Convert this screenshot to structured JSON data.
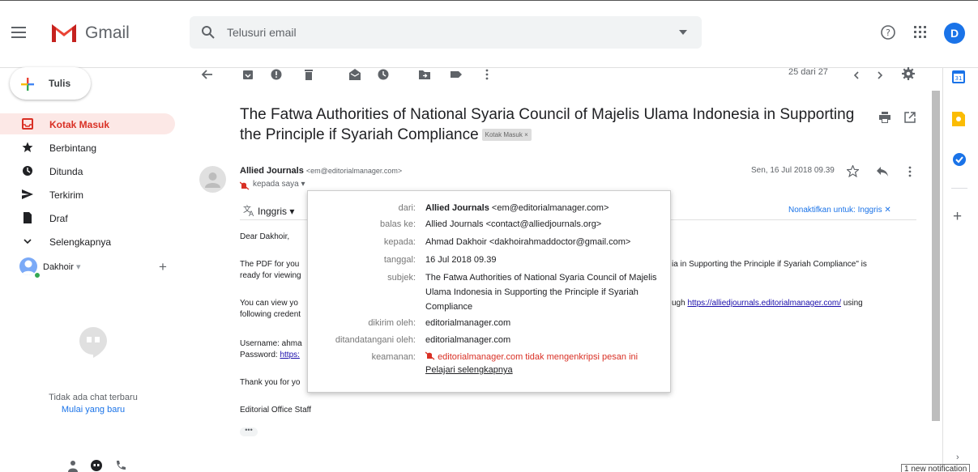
{
  "app": {
    "logo_text": "Gmail",
    "avatar_letter": "D"
  },
  "search": {
    "placeholder": "Telusuri email"
  },
  "compose": {
    "label": "Tulis"
  },
  "nav": [
    {
      "label": "Kotak Masuk",
      "icon": "inbox-icon",
      "active": true
    },
    {
      "label": "Berbintang",
      "icon": "star-icon",
      "active": false
    },
    {
      "label": "Ditunda",
      "icon": "clock-icon",
      "active": false
    },
    {
      "label": "Terkirim",
      "icon": "send-icon",
      "active": false
    },
    {
      "label": "Draf",
      "icon": "draft-icon",
      "active": false
    },
    {
      "label": "Selengkapnya",
      "icon": "chevron-down-icon",
      "active": false
    }
  ],
  "hangouts": {
    "user": "Dakhoir",
    "no_chat": "Tidak ada chat terbaru",
    "start_new": "Mulai yang baru"
  },
  "toolbar": {
    "count": "25 dari 27"
  },
  "email": {
    "subject": "The Fatwa Authorities of National Syaria Council of Majelis Ulama Indonesia in Supporting the Principle if Syariah Compliance",
    "label_chip": "Kotak Masuk ×",
    "sender_name": "Allied Journals",
    "sender_email": "<em@editorialmanager.com>",
    "recipient": "kepada saya",
    "date": "Sen, 16 Jul 2018 09.39",
    "translate_lang": "Inggris",
    "translate_off": "Nonaktifkan untuk: Inggris",
    "greeting": "Dear  Dakhoir,",
    "p1a": "The PDF for you",
    "p1b": "ia in Supporting the Principle if Syariah Compliance\" is",
    "p1c": "ready for viewing",
    "p2a": "You can view yo",
    "p2b": "ugh",
    "p2_link": "https://alliedjournals.editorialmanager.com/",
    "p2c": "using",
    "p2d": "following credent",
    "username": "Username: ahma",
    "password_label": "Password:",
    "password_link": "https:",
    "thanks": "Thank you for yo",
    "signature": "Editorial Office Staff",
    "ellipsis": "•••"
  },
  "popup": {
    "from_key": "dari:",
    "from_name": "Allied Journals",
    "from_email": "<em@editorialmanager.com>",
    "reply_key": "balas ke:",
    "reply_val": "Allied Journals <contact@alliedjournals.org>",
    "to_key": "kepada:",
    "to_val": "Ahmad Dakhoir <dakhoirahmaddoctor@gmail.com>",
    "date_key": "tanggal:",
    "date_val": "16 Jul 2018 09.39",
    "subject_key": "subjek:",
    "subject_val": "The Fatwa Authorities of National Syaria Council of Majelis Ulama Indonesia in Supporting the Principle if Syariah Compliance",
    "mailed_key": "dikirim oleh:",
    "mailed_val": "editorialmanager.com",
    "signed_key": "ditandatangani oleh:",
    "signed_val": "editorialmanager.com",
    "security_key": "keamanan:",
    "security_warn": "editorialmanager.com tidak mengenkripsi pesan ini",
    "learn_more": "Pelajari selengkapnya"
  },
  "notification": "1 new notification",
  "colors": {
    "accent_red": "#d93025",
    "link_blue": "#1a73e8",
    "active_bg": "#fce8e6"
  }
}
